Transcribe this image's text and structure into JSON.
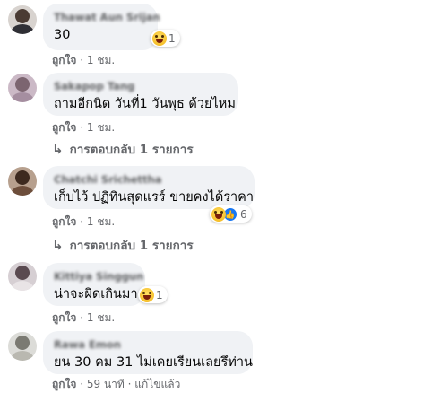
{
  "comments": [
    {
      "author": "Thawat Aun Srijan",
      "text": "30",
      "reaction_count": "1",
      "like": "ถูกใจ",
      "time": "1 ชม."
    },
    {
      "author": "Sakapop Tang",
      "text": "ถามอีกนิด วันที่1 วันพุธ ด้วยไหม",
      "like": "ถูกใจ",
      "time": "1 ชม.",
      "replies": "การตอบกลับ 1 รายการ"
    },
    {
      "author": "Chatchi Srichettha",
      "text": "เก็บไว้ ปฏิทินสุดแรร์ ขายคงได้ราคา",
      "reaction_count": "6",
      "like": "ถูกใจ",
      "time": "1 ชม.",
      "replies": "การตอบกลับ 1 รายการ"
    },
    {
      "author": "Kittiya Singgun",
      "text": "น่าจะผิดเกินมา",
      "reaction_count": "1",
      "like": "ถูกใจ",
      "time": "1 ชม."
    },
    {
      "author": "Rawa Emon",
      "text": "ยน 30 คม 31 ไม่เคยเรียนเลยรึท่าน",
      "like": "ถูกใจ",
      "time": "59 นาที",
      "edited": "แก้ไขแล้ว"
    }
  ],
  "separator": " · ",
  "icons": {
    "reaction_haha": "haha-emoji-icon",
    "reaction_like": "like-icon",
    "reply_arrow": "reply-arrow-icon"
  },
  "colors": {
    "bubble": "#f0f2f5",
    "meta_text": "#65676b",
    "like_blue": "#1877f2"
  }
}
